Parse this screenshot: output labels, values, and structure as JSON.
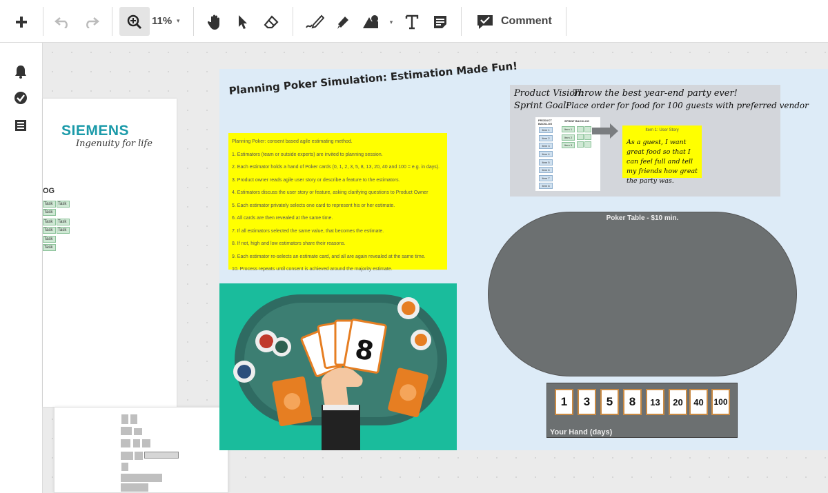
{
  "toolbar": {
    "zoom_value": "11%",
    "zoom_caret": "▾",
    "shape_caret": "▾",
    "comment_label": "Comment",
    "icons": [
      "plus-icon",
      "undo-icon",
      "redo-icon",
      "zoom-in-icon",
      "hand-icon",
      "pointer-icon",
      "eraser-icon",
      "pen-icon",
      "highlighter-icon",
      "shapes-icon",
      "text-icon",
      "sticky-note-icon",
      "comment-icon"
    ]
  },
  "rail": {
    "icons": [
      "bell-icon",
      "check-circle-icon",
      "list-icon"
    ]
  },
  "siemens_doc": {
    "brand": "SIEMENS",
    "tagline": "Ingenuity for life",
    "backlog_label": "OG",
    "task_label": "Task"
  },
  "board": {
    "title": "Planning Poker Simulation: Estimation Made Fun!",
    "rules": [
      "Planning Poker: consent based agile estimating method.",
      "1. Estimators (team or outside experts) are invited to planning session.",
      "2. Each estimator holds a hand of Poker cards (0, 1, 2, 3, 5, 8, 13, 20, 40 and 100 = e.g. in days).",
      "3. Product owner reads agile user story or describe a feature to the estimators.",
      "4. Estimators discuss the user story or feature, asking clarifying questions to Product Owner",
      "5. Each estimator privately selects one card to represent his or her estimate.",
      "6. All cards are then revealed at the same time.",
      "7. If all estimators selected the same value, that becomes the estimate.",
      "8. If not, high and low estimators share their reasons.",
      "9. Each estimator re-selects an estimate card, and all are again revealed at the same time.",
      "10. Process repeats until consent is achieved around the majority estimate."
    ],
    "vision": {
      "product_vision_label": "Product Vision:",
      "product_vision_text": "Throw the best year-end party ever!",
      "sprint_goal_label": "Sprint Goal:",
      "sprint_goal_text": "Place order for food for 100 guests with preferred vendor"
    },
    "backlog_diagram": {
      "product_backlog_label": "PRODUCT BACKLOG",
      "sprint_backlog_label": "SPRINT BACKLOG",
      "items": [
        "Item 1",
        "Item 2",
        "Item 3",
        "Item 4",
        "Item 5",
        "Item 6",
        "Item 7",
        "Item 8"
      ],
      "sprint_items": [
        "Item 1",
        "Item 2",
        "Item 3"
      ],
      "task_label": "Task"
    },
    "user_story": {
      "title": "Item 1: User Story",
      "text": "As a guest, I want great food so that I can feel full and tell my friends how great the party was."
    },
    "poker_table_label": "Poker Table - $10 min.",
    "hand": {
      "label": "Your Hand (days)",
      "cards": [
        "1",
        "3",
        "5",
        "8",
        "13",
        "20",
        "40",
        "100"
      ]
    }
  },
  "colors": {
    "board_bg": "#ddebf7",
    "sticky_yellow": "#ffff00",
    "table_gray": "#6c7071",
    "felt_teal": "#1abc9c",
    "siemens_teal": "#1b9aa9"
  }
}
